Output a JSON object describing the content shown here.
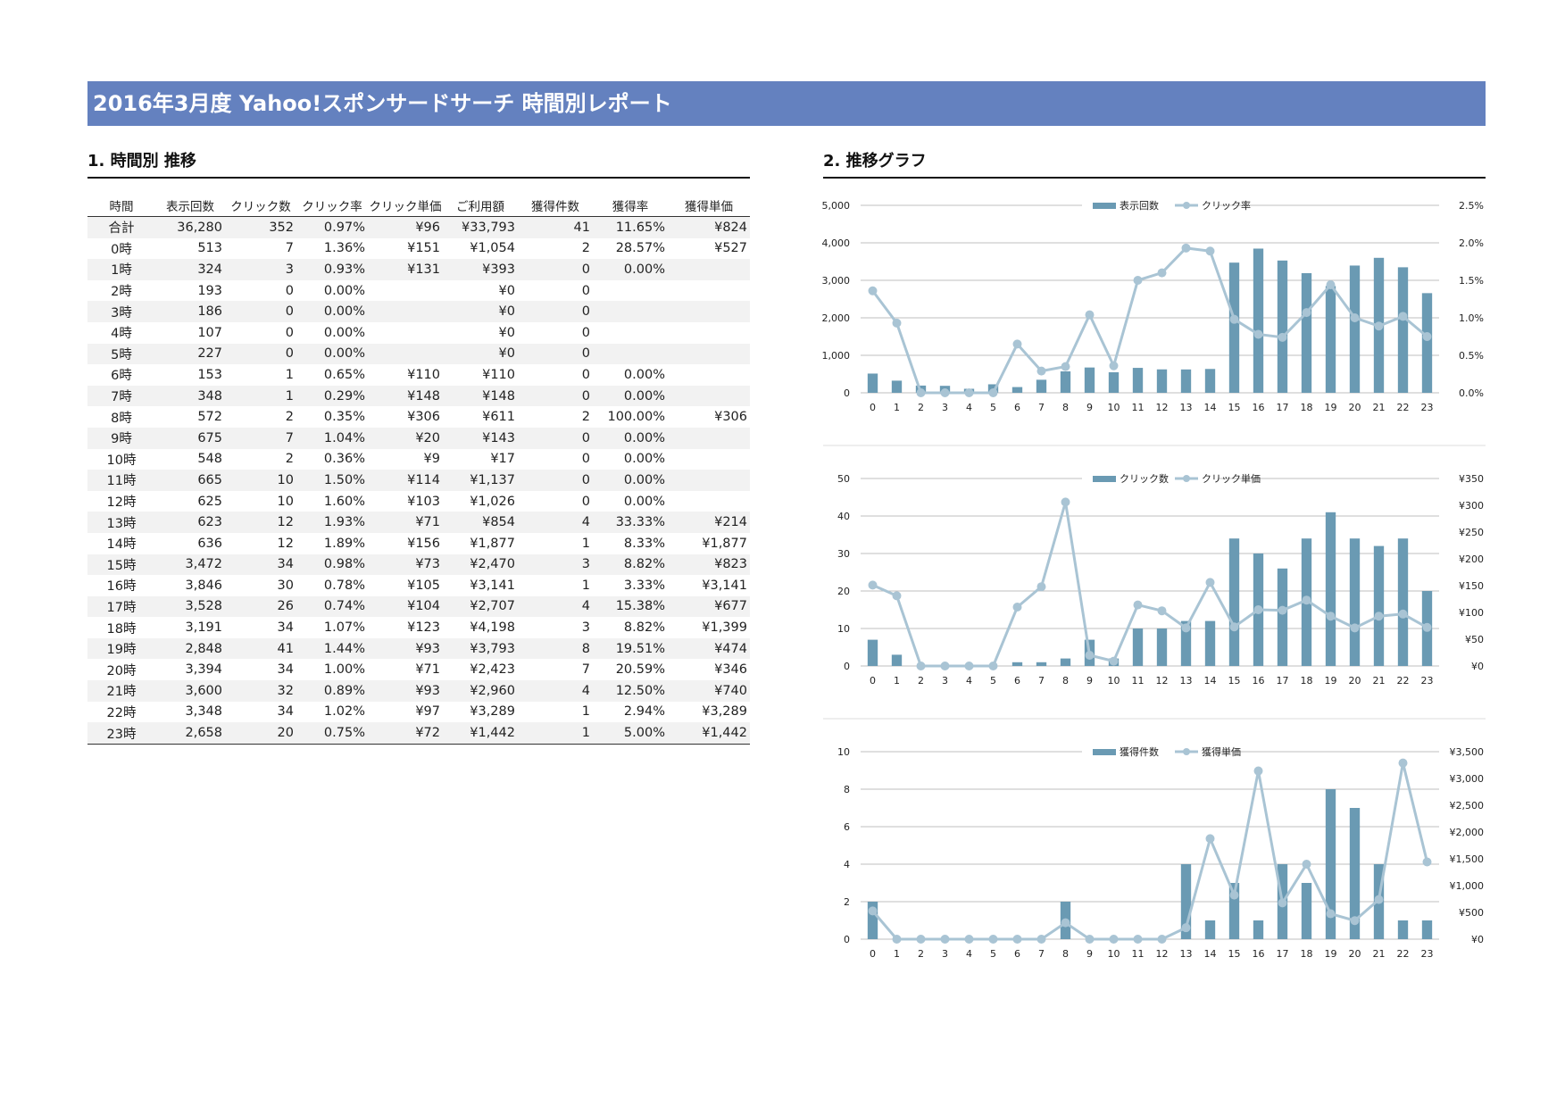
{
  "title": "2016年3月度 Yahoo!スポンサードサーチ 時間別レポート",
  "section1_title": "1. 時間別 推移",
  "section2_title": "2. 推移グラフ",
  "table": {
    "headers": [
      "時間",
      "表示回数",
      "クリック数",
      "クリック率",
      "クリック単価",
      "ご利用額",
      "獲得件数",
      "獲得率",
      "獲得単価"
    ],
    "rows": [
      [
        "合計",
        "36,280",
        "352",
        "0.97%",
        "¥96",
        "¥33,793",
        "41",
        "11.65%",
        "¥824"
      ],
      [
        "0時",
        "513",
        "7",
        "1.36%",
        "¥151",
        "¥1,054",
        "2",
        "28.57%",
        "¥527"
      ],
      [
        "1時",
        "324",
        "3",
        "0.93%",
        "¥131",
        "¥393",
        "0",
        "0.00%",
        ""
      ],
      [
        "2時",
        "193",
        "0",
        "0.00%",
        "",
        "¥0",
        "0",
        "",
        ""
      ],
      [
        "3時",
        "186",
        "0",
        "0.00%",
        "",
        "¥0",
        "0",
        "",
        ""
      ],
      [
        "4時",
        "107",
        "0",
        "0.00%",
        "",
        "¥0",
        "0",
        "",
        ""
      ],
      [
        "5時",
        "227",
        "0",
        "0.00%",
        "",
        "¥0",
        "0",
        "",
        ""
      ],
      [
        "6時",
        "153",
        "1",
        "0.65%",
        "¥110",
        "¥110",
        "0",
        "0.00%",
        ""
      ],
      [
        "7時",
        "348",
        "1",
        "0.29%",
        "¥148",
        "¥148",
        "0",
        "0.00%",
        ""
      ],
      [
        "8時",
        "572",
        "2",
        "0.35%",
        "¥306",
        "¥611",
        "2",
        "100.00%",
        "¥306"
      ],
      [
        "9時",
        "675",
        "7",
        "1.04%",
        "¥20",
        "¥143",
        "0",
        "0.00%",
        ""
      ],
      [
        "10時",
        "548",
        "2",
        "0.36%",
        "¥9",
        "¥17",
        "0",
        "0.00%",
        ""
      ],
      [
        "11時",
        "665",
        "10",
        "1.50%",
        "¥114",
        "¥1,137",
        "0",
        "0.00%",
        ""
      ],
      [
        "12時",
        "625",
        "10",
        "1.60%",
        "¥103",
        "¥1,026",
        "0",
        "0.00%",
        ""
      ],
      [
        "13時",
        "623",
        "12",
        "1.93%",
        "¥71",
        "¥854",
        "4",
        "33.33%",
        "¥214"
      ],
      [
        "14時",
        "636",
        "12",
        "1.89%",
        "¥156",
        "¥1,877",
        "1",
        "8.33%",
        "¥1,877"
      ],
      [
        "15時",
        "3,472",
        "34",
        "0.98%",
        "¥73",
        "¥2,470",
        "3",
        "8.82%",
        "¥823"
      ],
      [
        "16時",
        "3,846",
        "30",
        "0.78%",
        "¥105",
        "¥3,141",
        "1",
        "3.33%",
        "¥3,141"
      ],
      [
        "17時",
        "3,528",
        "26",
        "0.74%",
        "¥104",
        "¥2,707",
        "4",
        "15.38%",
        "¥677"
      ],
      [
        "18時",
        "3,191",
        "34",
        "1.07%",
        "¥123",
        "¥4,198",
        "3",
        "8.82%",
        "¥1,399"
      ],
      [
        "19時",
        "2,848",
        "41",
        "1.44%",
        "¥93",
        "¥3,793",
        "8",
        "19.51%",
        "¥474"
      ],
      [
        "20時",
        "3,394",
        "34",
        "1.00%",
        "¥71",
        "¥2,423",
        "7",
        "20.59%",
        "¥346"
      ],
      [
        "21時",
        "3,600",
        "32",
        "0.89%",
        "¥93",
        "¥2,960",
        "4",
        "12.50%",
        "¥740"
      ],
      [
        "22時",
        "3,348",
        "34",
        "1.02%",
        "¥97",
        "¥3,289",
        "1",
        "2.94%",
        "¥3,289"
      ],
      [
        "23時",
        "2,658",
        "20",
        "0.75%",
        "¥72",
        "¥1,442",
        "1",
        "5.00%",
        "¥1,442"
      ]
    ]
  },
  "colors": {
    "banner": "#6481bf",
    "bar": "#6a9ab3",
    "line": "#a9c4d4",
    "grid": "#bfbfbf"
  },
  "chart_data": [
    {
      "type": "bar",
      "combo": "bar+line",
      "categories": [
        "0",
        "1",
        "2",
        "3",
        "4",
        "5",
        "6",
        "7",
        "8",
        "9",
        "10",
        "11",
        "12",
        "13",
        "14",
        "15",
        "16",
        "17",
        "18",
        "19",
        "20",
        "21",
        "22",
        "23"
      ],
      "series": [
        {
          "name": "表示回数",
          "type": "bar",
          "axis": "left",
          "values": [
            513,
            324,
            193,
            186,
            107,
            227,
            153,
            348,
            572,
            675,
            548,
            665,
            625,
            623,
            636,
            3472,
            3846,
            3528,
            3191,
            2848,
            3394,
            3600,
            3348,
            2658
          ]
        },
        {
          "name": "クリック率",
          "type": "line",
          "axis": "right",
          "values": [
            1.36,
            0.93,
            0.0,
            0.0,
            0.0,
            0.0,
            0.65,
            0.29,
            0.35,
            1.04,
            0.36,
            1.5,
            1.6,
            1.93,
            1.89,
            0.98,
            0.78,
            0.74,
            1.07,
            1.44,
            1.0,
            0.89,
            1.02,
            0.75
          ]
        }
      ],
      "ylim_left": [
        0,
        5000
      ],
      "left_ticks": [
        "0",
        "1,000",
        "2,000",
        "3,000",
        "4,000",
        "5,000"
      ],
      "ylim_right": [
        0,
        2.5
      ],
      "right_ticks": [
        "0.0%",
        "0.5%",
        "1.0%",
        "1.5%",
        "2.0%",
        "2.5%"
      ],
      "legend": "top-center",
      "grid": true
    },
    {
      "type": "bar",
      "combo": "bar+line",
      "categories": [
        "0",
        "1",
        "2",
        "3",
        "4",
        "5",
        "6",
        "7",
        "8",
        "9",
        "10",
        "11",
        "12",
        "13",
        "14",
        "15",
        "16",
        "17",
        "18",
        "19",
        "20",
        "21",
        "22",
        "23"
      ],
      "series": [
        {
          "name": "クリック数",
          "type": "bar",
          "axis": "left",
          "values": [
            7,
            3,
            0,
            0,
            0,
            0,
            1,
            1,
            2,
            7,
            2,
            10,
            10,
            12,
            12,
            34,
            30,
            26,
            34,
            41,
            34,
            32,
            34,
            20
          ]
        },
        {
          "name": "クリック単価",
          "type": "line",
          "axis": "right",
          "values": [
            151,
            131,
            0,
            0,
            0,
            0,
            110,
            148,
            306,
            20,
            9,
            114,
            103,
            71,
            156,
            73,
            105,
            104,
            123,
            93,
            71,
            93,
            97,
            72
          ]
        }
      ],
      "ylim_left": [
        0,
        50
      ],
      "left_ticks": [
        "0",
        "10",
        "20",
        "30",
        "40",
        "50"
      ],
      "ylim_right": [
        0,
        350
      ],
      "right_ticks": [
        "¥0",
        "¥50",
        "¥100",
        "¥150",
        "¥200",
        "¥250",
        "¥300",
        "¥350"
      ],
      "legend": "top-center",
      "grid": true
    },
    {
      "type": "bar",
      "combo": "bar+line",
      "categories": [
        "0",
        "1",
        "2",
        "3",
        "4",
        "5",
        "6",
        "7",
        "8",
        "9",
        "10",
        "11",
        "12",
        "13",
        "14",
        "15",
        "16",
        "17",
        "18",
        "19",
        "20",
        "21",
        "22",
        "23"
      ],
      "series": [
        {
          "name": "獲得件数",
          "type": "bar",
          "axis": "left",
          "values": [
            2,
            0,
            0,
            0,
            0,
            0,
            0,
            0,
            2,
            0,
            0,
            0,
            0,
            4,
            1,
            3,
            1,
            4,
            3,
            8,
            7,
            4,
            1,
            1
          ]
        },
        {
          "name": "獲得単価",
          "type": "line",
          "axis": "right",
          "values": [
            527,
            0,
            0,
            0,
            0,
            0,
            0,
            0,
            306,
            0,
            0,
            0,
            0,
            214,
            1877,
            823,
            3141,
            677,
            1399,
            474,
            346,
            740,
            3289,
            1442
          ]
        }
      ],
      "ylim_left": [
        0,
        10
      ],
      "left_ticks": [
        "0",
        "2",
        "4",
        "6",
        "8",
        "10"
      ],
      "ylim_right": [
        0,
        3500
      ],
      "right_ticks": [
        "¥0",
        "¥500",
        "¥1,000",
        "¥1,500",
        "¥2,000",
        "¥2,500",
        "¥3,000",
        "¥3,500"
      ],
      "legend": "top-center",
      "grid": true
    }
  ]
}
